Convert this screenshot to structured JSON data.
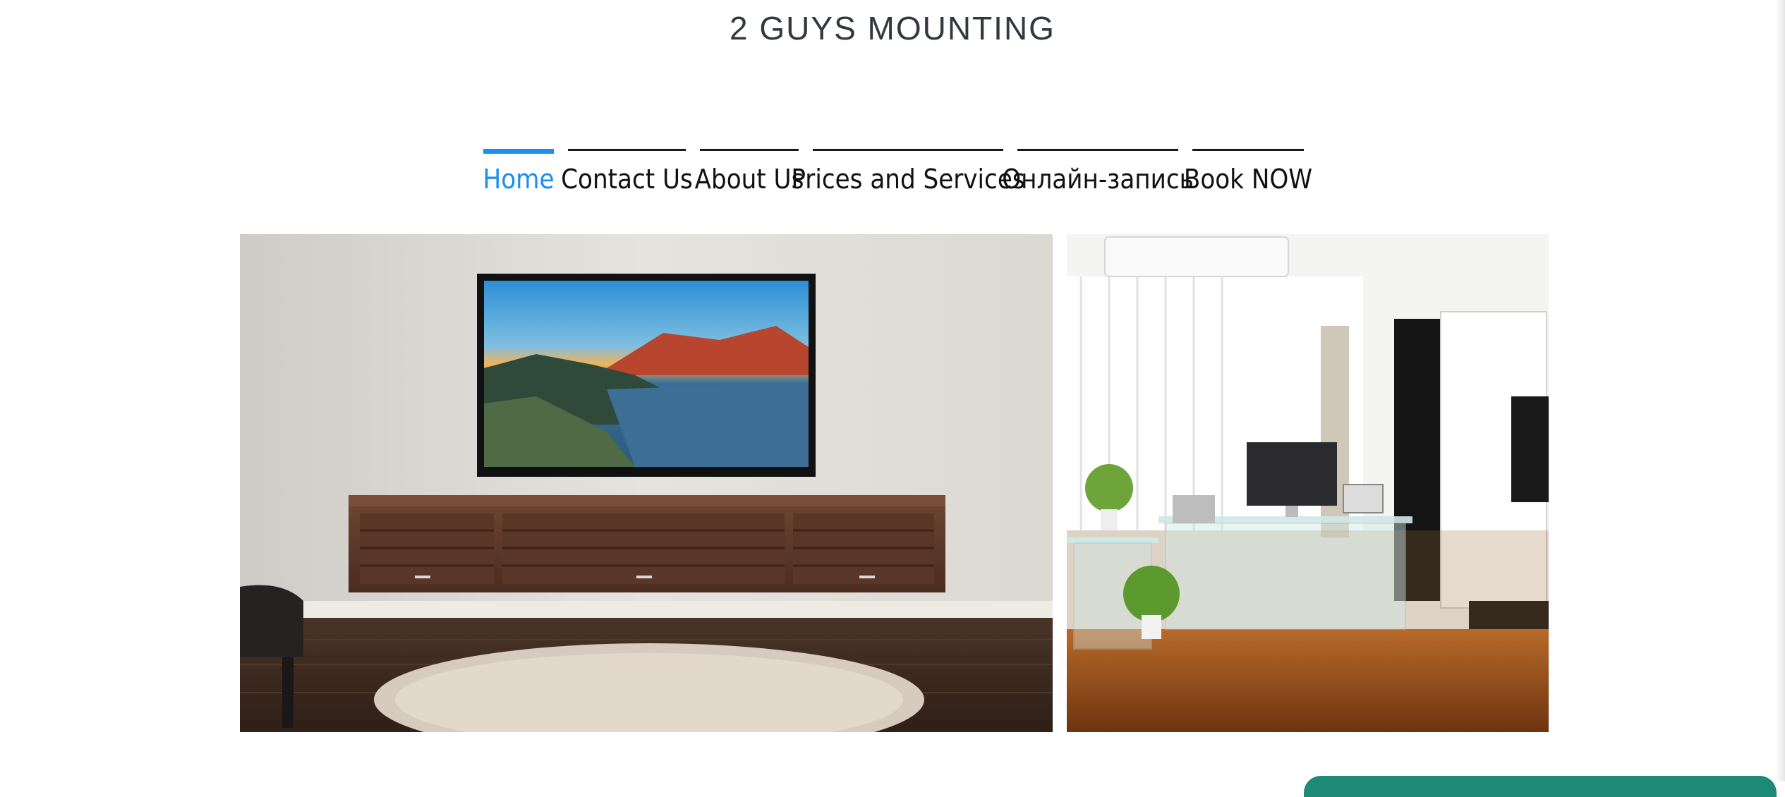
{
  "site": {
    "title": "2 GUYS MOUNTING"
  },
  "nav": {
    "items": [
      {
        "label": "Home",
        "active": true
      },
      {
        "label": "Contact Us",
        "active": false
      },
      {
        "label": "About Us",
        "active": false
      },
      {
        "label": "Prices and Services",
        "active": false
      },
      {
        "label": "Онлайн-запись",
        "active": false
      },
      {
        "label": "Book NOW",
        "active": false
      }
    ]
  },
  "slider": {
    "slides": [
      {
        "name": "wall-mounted-tv-with-floating-cabinet"
      },
      {
        "name": "office-room-with-glass-desk-and-mounted-tv"
      }
    ],
    "next_icon": "chevron-right-icon"
  },
  "colors": {
    "accent": "#1a8ff0",
    "nav_border": "#1a1a1a",
    "title": "#333840"
  }
}
